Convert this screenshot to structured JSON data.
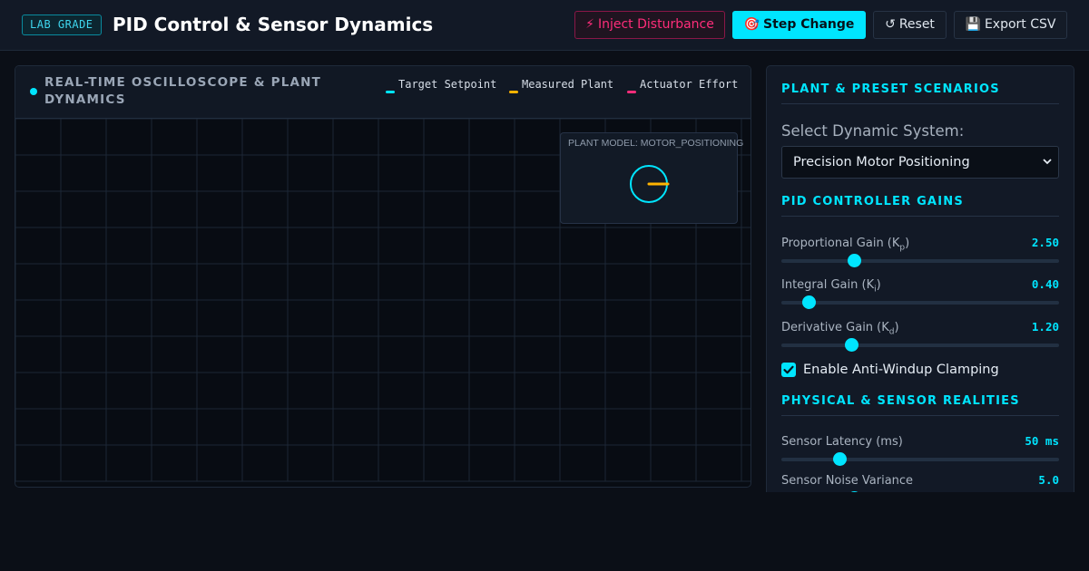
{
  "header": {
    "badge": "LAB GRADE",
    "title": "PID Control & Sensor Dynamics",
    "buttons": {
      "disturbance": {
        "icon": "⚡",
        "label": "Inject Disturbance"
      },
      "step": {
        "icon": "🎯",
        "label": "Step Change"
      },
      "reset": {
        "icon": "↺",
        "label": "Reset"
      },
      "export": {
        "icon": "💾",
        "label": "Export CSV"
      }
    }
  },
  "scope": {
    "title": "REAL-TIME OSCILLOSCOPE & PLANT DYNAMICS",
    "legend": [
      {
        "label": "Target Setpoint",
        "color": "#00e5ff"
      },
      {
        "label": "Measured Plant",
        "color": "#ffb300"
      },
      {
        "label": "Actuator Effort",
        "color": "#ff2d7a"
      }
    ],
    "plant_model_label": "PLANT MODEL: MOTOR_POSITIONING"
  },
  "panel": {
    "section_plant": "PLANT & PRESET SCENARIOS",
    "select_label": "Select Dynamic System:",
    "select_value": "Precision Motor Positioning",
    "section_gains": "PID CONTROLLER GAINS",
    "gains": [
      {
        "label": "Proportional Gain (K",
        "sub": "p",
        "suffix": ")",
        "value": "2.50",
        "level": 0.26
      },
      {
        "label": "Integral Gain (K",
        "sub": "i",
        "suffix": ")",
        "value": "0.40",
        "level": 0.098
      },
      {
        "label": "Derivative Gain (K",
        "sub": "d",
        "suffix": ")",
        "value": "1.20",
        "level": 0.25
      }
    ],
    "anti_windup_label": "Enable Anti-Windup Clamping",
    "anti_windup_checked": true,
    "section_sensor": "PHYSICAL & SENSOR REALITIES",
    "sensor": [
      {
        "label": "Sensor Latency (ms)",
        "value": "50 ms",
        "level": 0.21
      },
      {
        "label": "Sensor Noise Variance",
        "value": "5.0",
        "level": 0.26
      }
    ]
  },
  "colors": {
    "accent": "#00e5ff",
    "plant": "#ffb300",
    "actuator": "#ff2d7a",
    "background": "#0b0f17"
  },
  "icons": [
    "lightning-icon",
    "target-icon",
    "reset-icon",
    "floppy-disk-icon",
    "chevron-down-icon",
    "checkmark-icon"
  ]
}
